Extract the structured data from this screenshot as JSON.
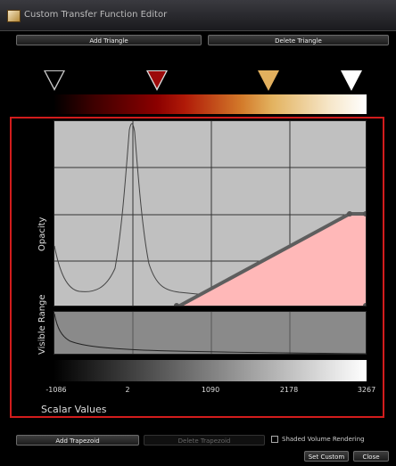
{
  "window": {
    "title": "Custom Transfer Function Editor",
    "icon": "app-icon"
  },
  "toolbar": {
    "add_triangle": "Add Triangle",
    "delete_triangle": "Delete Triangle"
  },
  "color_markers": [
    {
      "name": "marker-black",
      "color": "#000000"
    },
    {
      "name": "marker-dark-red",
      "color": "#9b0b0b"
    },
    {
      "name": "marker-gold",
      "color": "#e2b05e"
    },
    {
      "name": "marker-white",
      "color": "#ffffff"
    }
  ],
  "plot": {
    "ylabel": "Opacity",
    "background": "#c0c0c0",
    "triangle_fill": "#ffb8b8"
  },
  "visible_range": {
    "label": "Visible Range"
  },
  "axis": {
    "ticks": [
      "-1086",
      "2",
      "1090",
      "2178",
      "3267"
    ],
    "xlabel": "Scalar Values"
  },
  "bottom": {
    "add_trapezoid": "Add Trapezoid",
    "delete_trapezoid": "Delete Trapezoid",
    "shaded_checked": false,
    "shaded_label": "Shaded Volume Rendering",
    "set_custom": "Set Custom",
    "close": "Close"
  },
  "accent": "#d21c1c"
}
